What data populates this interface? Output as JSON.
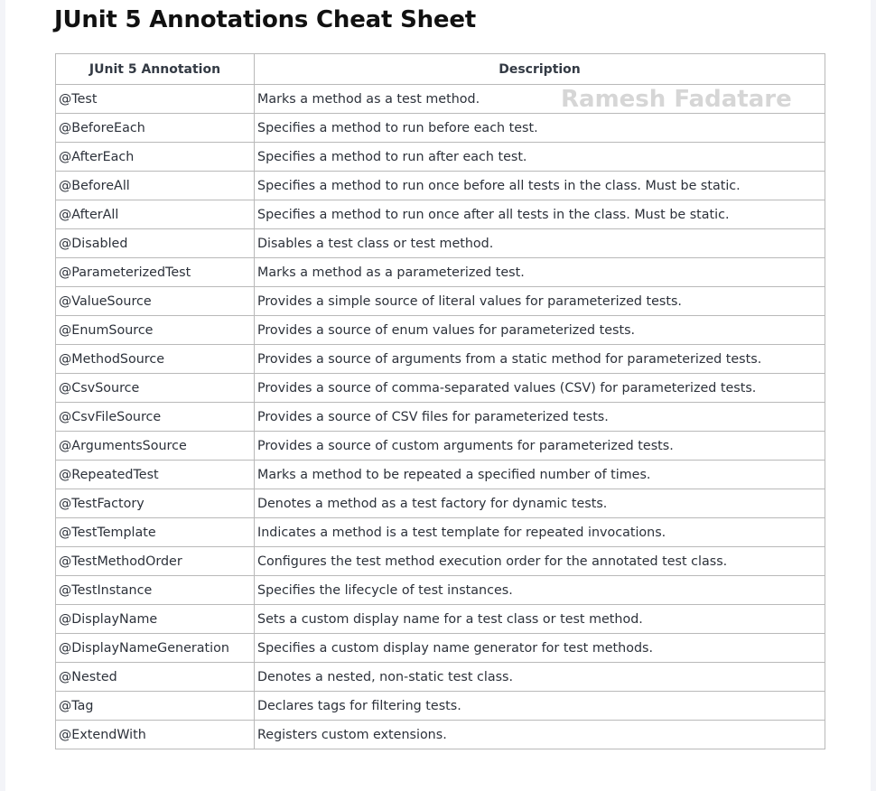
{
  "title": "JUnit 5 Annotations Cheat Sheet",
  "watermark": "Ramesh Fadatare",
  "table": {
    "headers": [
      "JUnit 5 Annotation",
      "Description"
    ],
    "rows": [
      {
        "annotation": "@Test",
        "description": "Marks a method as a test method."
      },
      {
        "annotation": "@BeforeEach",
        "description": "Specifies a method to run before each test."
      },
      {
        "annotation": "@AfterEach",
        "description": "Specifies a method to run after each test."
      },
      {
        "annotation": "@BeforeAll",
        "description": "Specifies a method to run once before all tests in the class. Must be static."
      },
      {
        "annotation": "@AfterAll",
        "description": "Specifies a method to run once after all tests in the class. Must be static."
      },
      {
        "annotation": "@Disabled",
        "description": "Disables a test class or test method."
      },
      {
        "annotation": "@ParameterizedTest",
        "description": "Marks a method as a parameterized test."
      },
      {
        "annotation": "@ValueSource",
        "description": "Provides a simple source of literal values for parameterized tests."
      },
      {
        "annotation": "@EnumSource",
        "description": "Provides a source of enum values for parameterized tests."
      },
      {
        "annotation": "@MethodSource",
        "description": "Provides a source of arguments from a static method for parameterized tests."
      },
      {
        "annotation": "@CsvSource",
        "description": "Provides a source of comma-separated values (CSV) for parameterized tests."
      },
      {
        "annotation": "@CsvFileSource",
        "description": "Provides a source of CSV files for parameterized tests."
      },
      {
        "annotation": "@ArgumentsSource",
        "description": "Provides a source of custom arguments for parameterized tests."
      },
      {
        "annotation": "@RepeatedTest",
        "description": "Marks a method to be repeated a specified number of times."
      },
      {
        "annotation": "@TestFactory",
        "description": "Denotes a method as a test factory for dynamic tests."
      },
      {
        "annotation": "@TestTemplate",
        "description": "Indicates a method is a test template for repeated invocations."
      },
      {
        "annotation": "@TestMethodOrder",
        "description": "Configures the test method execution order for the annotated test class."
      },
      {
        "annotation": "@TestInstance",
        "description": "Specifies the lifecycle of test instances."
      },
      {
        "annotation": "@DisplayName",
        "description": "Sets a custom display name for a test class or test method."
      },
      {
        "annotation": "@DisplayNameGeneration",
        "description": "Specifies a custom display name generator for test methods."
      },
      {
        "annotation": "@Nested",
        "description": "Denotes a nested, non-static test class."
      },
      {
        "annotation": "@Tag",
        "description": "Declares tags for filtering tests."
      },
      {
        "annotation": "@ExtendWith",
        "description": "Registers custom extensions."
      }
    ]
  }
}
